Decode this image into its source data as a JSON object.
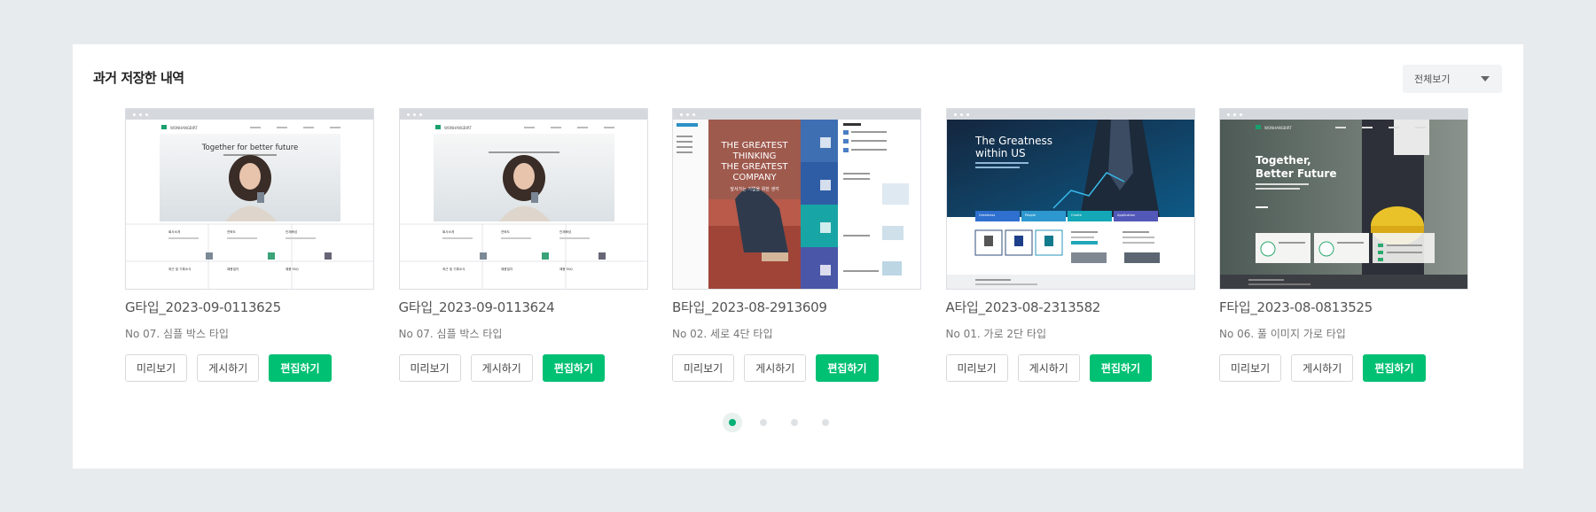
{
  "section_title": "과거 저장한 내역",
  "filter": {
    "selected": "전체보기"
  },
  "buttons": {
    "preview": "미리보기",
    "publish": "게시하기",
    "edit": "편집하기"
  },
  "accent_color": "#00c073",
  "cards": [
    {
      "title": "G타입_2023-09-0113625",
      "subtitle": "No 07. 심플 박스 타입",
      "preview": {
        "brand": "WONHANGBIRT",
        "hero_text": "Together for better future",
        "tiles": [
          "회사소개",
          "연혁도",
          "인재육성",
          "최근 및 기록소식",
          "채용절차",
          "채용 FAQ"
        ]
      }
    },
    {
      "title": "G타입_2023-09-0113624",
      "subtitle": "No 07. 심플 박스 타입",
      "preview": {
        "brand": "WONHANGBIRT",
        "tiles": [
          "회사소개",
          "연혁도",
          "인재육성",
          "최근 및 기록소식",
          "채용절차",
          "채용 FAQ"
        ]
      }
    },
    {
      "title": "B타입_2023-08-2913609",
      "subtitle": "No 02. 세로 4단 타입",
      "preview": {
        "hero_lines": [
          "THE GREATEST",
          "THINKING",
          "THE GREATEST",
          "COMPANY"
        ],
        "hero_sub": "앞서가는 기업을 위한 생각"
      }
    },
    {
      "title": "A타입_2023-08-2313582",
      "subtitle": "No 01. 가로 2단 타입",
      "preview": {
        "hero_lines": [
          "The Greatness",
          "within US"
        ],
        "tabs": [
          "Greatness",
          "People",
          "Create",
          "Application"
        ]
      }
    },
    {
      "title": "F타입_2023-08-0813525",
      "subtitle": "No 06. 풀 이미지 가로 타입",
      "preview": {
        "brand": "WONHANGBIRT",
        "hero_lines": [
          "Together,",
          "Better Future"
        ]
      }
    }
  ],
  "pagination": {
    "pages": 4,
    "current": 1
  }
}
